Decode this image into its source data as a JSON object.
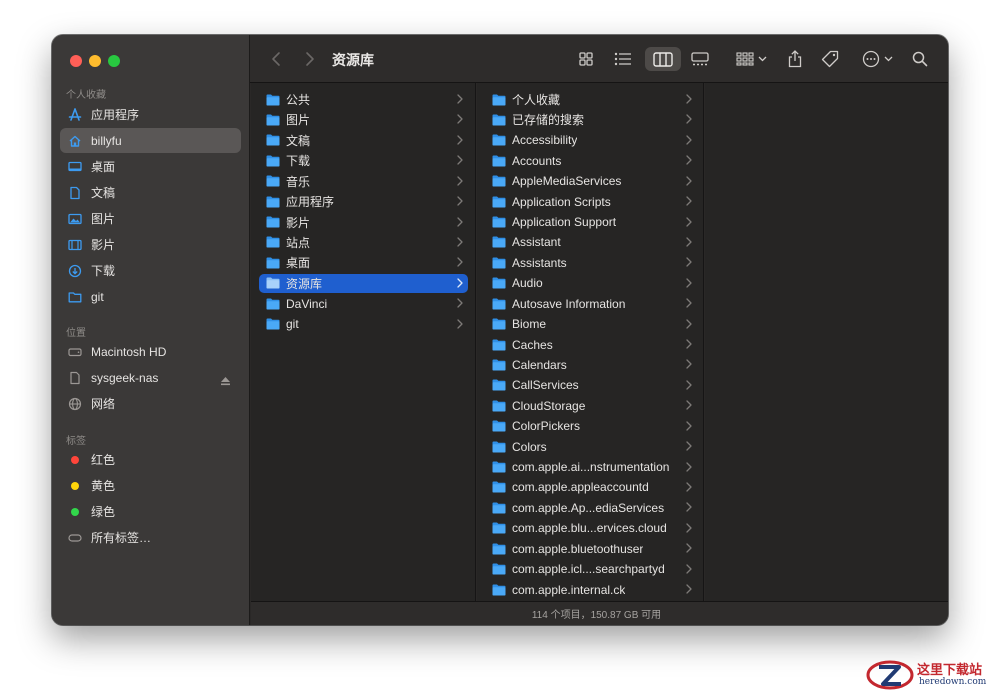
{
  "toolbar": {
    "title": "资源库"
  },
  "sidebar": {
    "sections": {
      "favorites": "个人收藏",
      "locations": "位置",
      "tags": "标签"
    },
    "favorites": [
      {
        "label": "应用程序",
        "icon": "applications-icon"
      },
      {
        "label": "billyfu",
        "icon": "home-icon",
        "selected": true
      },
      {
        "label": "桌面",
        "icon": "desktop-icon"
      },
      {
        "label": "文稿",
        "icon": "document-icon"
      },
      {
        "label": "图片",
        "icon": "pictures-icon"
      },
      {
        "label": "影片",
        "icon": "movies-icon"
      },
      {
        "label": "下载",
        "icon": "downloads-icon"
      },
      {
        "label": "git",
        "icon": "folder-icon"
      }
    ],
    "locations": [
      {
        "label": "Macintosh HD",
        "icon": "disk-icon"
      },
      {
        "label": "sysgeek-nas",
        "icon": "network-drive-icon"
      },
      {
        "label": "网络",
        "icon": "network-globe-icon"
      }
    ],
    "tags": [
      {
        "label": "红色",
        "color": "#ff453a"
      },
      {
        "label": "黄色",
        "color": "#ffd60a"
      },
      {
        "label": "绿色",
        "color": "#32d74b"
      },
      {
        "label": "所有标签…",
        "icon": "all-tags-icon"
      }
    ]
  },
  "column1": [
    {
      "label": "公共"
    },
    {
      "label": "图片"
    },
    {
      "label": "文稿"
    },
    {
      "label": "下载"
    },
    {
      "label": "音乐"
    },
    {
      "label": "应用程序"
    },
    {
      "label": "影片"
    },
    {
      "label": "站点"
    },
    {
      "label": "桌面"
    },
    {
      "label": "资源库",
      "selected": true
    },
    {
      "label": "DaVinci"
    },
    {
      "label": "git"
    }
  ],
  "column2": [
    {
      "label": "个人收藏"
    },
    {
      "label": "已存储的搜索"
    },
    {
      "label": "Accessibility"
    },
    {
      "label": "Accounts"
    },
    {
      "label": "AppleMediaServices"
    },
    {
      "label": "Application Scripts"
    },
    {
      "label": "Application Support"
    },
    {
      "label": "Assistant"
    },
    {
      "label": "Assistants"
    },
    {
      "label": "Audio"
    },
    {
      "label": "Autosave Information"
    },
    {
      "label": "Biome"
    },
    {
      "label": "Caches"
    },
    {
      "label": "Calendars"
    },
    {
      "label": "CallServices"
    },
    {
      "label": "CloudStorage"
    },
    {
      "label": "ColorPickers"
    },
    {
      "label": "Colors"
    },
    {
      "label": "com.apple.ai...nstrumentation"
    },
    {
      "label": "com.apple.appleaccountd"
    },
    {
      "label": "com.apple.Ap...ediaServices"
    },
    {
      "label": "com.apple.blu...ervices.cloud"
    },
    {
      "label": "com.apple.bluetoothuser"
    },
    {
      "label": "com.apple.icl....searchpartyd"
    },
    {
      "label": "com.apple.internal.ck"
    }
  ],
  "status": {
    "text": "114 个项目，150.87 GB 可用"
  },
  "watermark": {
    "brand": "这里下载站",
    "url": "heredown.com"
  },
  "colors": {
    "accent": "#1f5fcf",
    "folder": "#3ba0f5",
    "sidebar_icon": "#3d9bf0"
  }
}
